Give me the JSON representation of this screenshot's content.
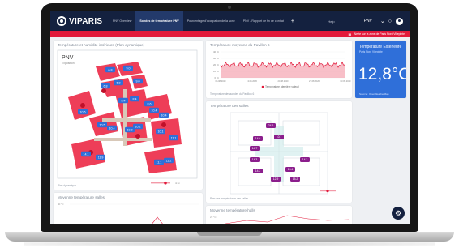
{
  "brand": {
    "name": "VIPARIS"
  },
  "tabs": [
    {
      "label": "PNV Overview",
      "active": false
    },
    {
      "label": "Sondes de température PNV",
      "active": true
    },
    {
      "label": "Pourcentage d'occupation de la zone",
      "active": false
    },
    {
      "label": "PNV - Rapport de fin de contrat",
      "active": false
    }
  ],
  "topbar": {
    "help": "Help",
    "site_select": "PNV",
    "add_tab": "+"
  },
  "alert": {
    "text": "Alerte sur la zone de Paris Nord Villepinte"
  },
  "map_panel": {
    "title": "Température et humidité intérieure (Plan dynamique)",
    "site_label": "PNV",
    "site_sub": "Exposition",
    "footer": "Plan dynamique"
  },
  "map_sensors": [
    "6.8",
    "9.0",
    "6.8",
    "6.8",
    "9.0",
    "8.4",
    "8.4",
    "8.6",
    "10.5",
    "10.5",
    "10.4",
    "10.4",
    "10.4",
    "10.2",
    "10.2",
    "10.1",
    "11.1",
    "11.2",
    "14.1",
    "11.9",
    "11.1"
  ],
  "ts_panel": {
    "title": "Température moyenne du Pavillon 6",
    "legend": "Température (dernière valeur)",
    "footer": "Température des sondes du Pavillon 6",
    "chart_data": {
      "type": "line",
      "x_ticks": [
        "06.08.2020",
        "13.08.2020",
        "20.08.2020",
        "27.08.2020",
        "03.09.2020"
      ],
      "y_ticks": [
        "40 °C",
        "30 °C",
        "20 °C",
        "10 °C",
        "0 °C"
      ],
      "ylim": [
        0,
        40
      ],
      "series": [
        {
          "name": "Température (dernière valeur)",
          "color": "#e21a3b"
        }
      ]
    }
  },
  "kpi": {
    "title": "Température Extérieure",
    "subtitle": "Paris Nord Villepinte",
    "value": "12,8°C",
    "footer": "Source : OpenWeatherMap"
  },
  "plan_panel": {
    "title": "Température des salles",
    "footer": "Plan des températures des salles",
    "tags": [
      "24.6",
      "14.6",
      "14.7",
      "14.3",
      "14.2",
      "15.4",
      "12.9",
      "15.2",
      "14.3",
      "10.7"
    ]
  },
  "avg1": {
    "title": "Moyenne température salles",
    "axis": "40 °C"
  },
  "avg2": {
    "title": "Moyenne température halls",
    "axis": "23 °C"
  },
  "colors": {
    "navy": "#14213f",
    "accent_red": "#e21a3b",
    "kpi_blue": "#2f6fd9",
    "purple": "#8b1e8c"
  }
}
